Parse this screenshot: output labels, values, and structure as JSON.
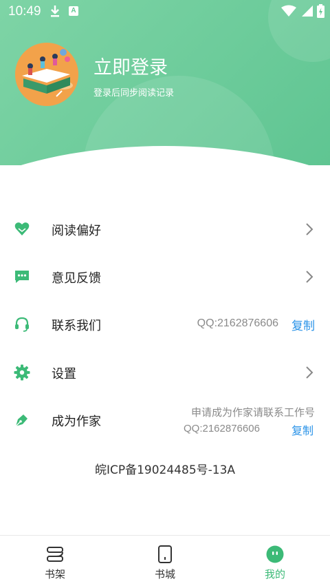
{
  "status_bar": {
    "time": "10:49"
  },
  "header": {
    "login_title": "立即登录",
    "login_subtitle": "登录后同步阅读记录"
  },
  "menu": {
    "reading_prefs": "阅读偏好",
    "feedback": "意见反馈",
    "contact": "联系我们",
    "contact_qq": "QQ:2162876606",
    "contact_copy": "复制",
    "settings": "设置",
    "become_author": "成为作家",
    "author_note": "申请成为作家请联系工作号",
    "author_qq": "QQ:2162876606",
    "author_copy": "复制"
  },
  "icp": "皖ICP备19024485号-13A",
  "tabs": [
    {
      "label": "书架",
      "icon": "bookshelf-icon"
    },
    {
      "label": "书城",
      "icon": "bookstore-icon"
    },
    {
      "label": "我的",
      "icon": "profile-icon"
    }
  ],
  "colors": {
    "accent": "#3cba77",
    "link": "#2a93e8"
  }
}
